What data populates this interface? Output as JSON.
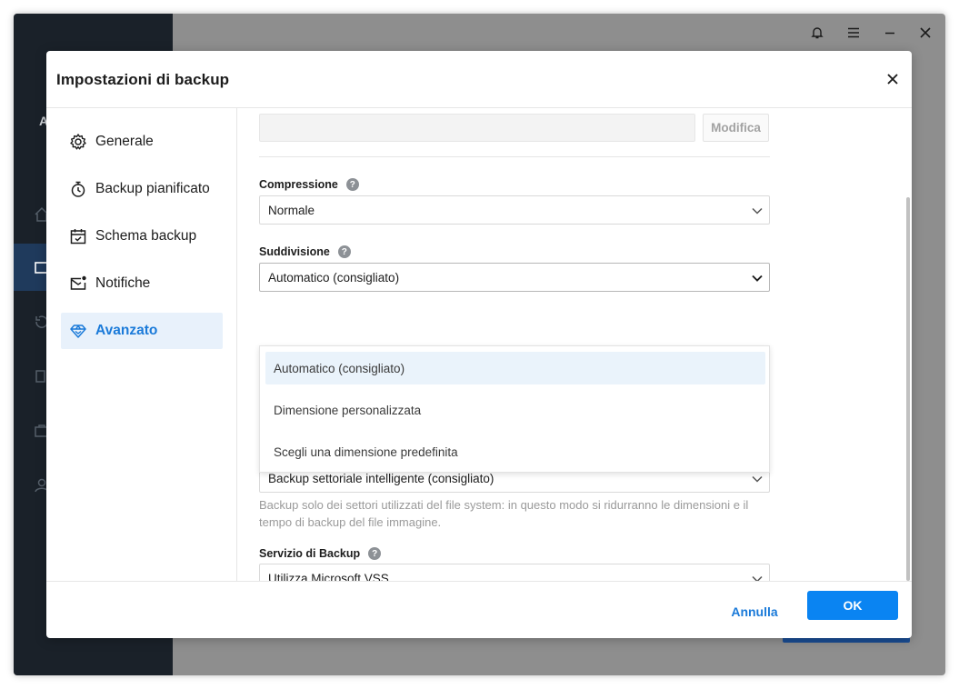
{
  "app": {
    "window_controls": [
      "bell-icon",
      "menu-icon",
      "minimize-icon",
      "close-icon"
    ],
    "sidebar_icons": [
      "home-icon",
      "backup-icon",
      "restore-icon",
      "clone-icon",
      "tools-icon",
      "account-icon"
    ],
    "sidebar_fragment": "A"
  },
  "dialog": {
    "title": "Impostazioni di backup",
    "close_icon": "close-icon"
  },
  "nav": {
    "items": [
      {
        "label": "Generale",
        "icon": "gear-icon",
        "active": false
      },
      {
        "label": "Backup pianificato",
        "icon": "stopwatch-icon",
        "active": false
      },
      {
        "label": "Schema backup",
        "icon": "calendar-check-icon",
        "active": false
      },
      {
        "label": "Notifiche",
        "icon": "mail-notification-icon",
        "active": false
      },
      {
        "label": "Avanzato",
        "icon": "diamond-icon",
        "active": true
      }
    ]
  },
  "content": {
    "path_value": "",
    "modifica_label": "Modifica",
    "compression": {
      "label": "Compressione",
      "value": "Normale"
    },
    "splitting": {
      "label": "Suddivisione",
      "value": "Automatico (consigliato)",
      "options": [
        "Automatico (consigliato)",
        "Dimensione personalizzata",
        "Scegli una dimensione predefinita"
      ],
      "highlighted_index": 0
    },
    "sector_mode": {
      "value": "Backup settoriale intelligente (consigliato)",
      "description": "Backup solo dei settori utilizzati del file system: in questo modo si ridurranno le dimensioni e il tempo di backup del file immagine."
    },
    "backup_service": {
      "label": "Servizio di Backup",
      "value": "Utilizza Microsoft VSS"
    }
  },
  "footer": {
    "cancel_label": "Annulla",
    "ok_label": "OK"
  },
  "colors": {
    "accent": "#0a84f2",
    "link": "#1a7ad9",
    "nav_active_bg": "#e8f1fb",
    "app_sidebar": "#1a2129"
  }
}
